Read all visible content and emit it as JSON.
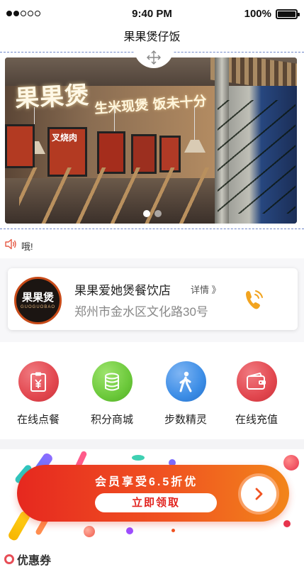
{
  "status_bar": {
    "time": "9:40 PM",
    "battery_label": "100%",
    "signal_icon": "signal-dots-icon",
    "battery_icon": "battery-icon"
  },
  "nav": {
    "title": "果果煲仔饭"
  },
  "banner": {
    "sign_text": "果果煲",
    "slogan_text": "生米现煲 饭未十分",
    "poster_texts": [
      "叉烧肉"
    ],
    "page_count": 2,
    "active_page": 1,
    "move_icon": "move-arrows-icon"
  },
  "notice": {
    "icon": "speaker-icon",
    "text": "哦!"
  },
  "store": {
    "logo_text": "果果煲",
    "logo_subtext": "GUOGUOBAO",
    "name": "果果爱她煲餐饮店",
    "detail_label": "详情 》",
    "address": "郑州市金水区文化路30号",
    "phone_icon": "phone-icon"
  },
  "menu": [
    {
      "label": "在线点餐",
      "icon": "clipboard-yuan-icon",
      "color": "#e2474f"
    },
    {
      "label": "积分商城",
      "icon": "coin-stack-icon",
      "color": "#6cc93b"
    },
    {
      "label": "步数精灵",
      "icon": "walking-person-icon",
      "color": "#3c8de6"
    },
    {
      "label": "在线充值",
      "icon": "wallet-icon",
      "color": "#e2474f"
    }
  ],
  "promo": {
    "title": "会员享受6.5折优",
    "button_label": "立即领取",
    "arrow_icon": "chevron-right-icon",
    "colors": {
      "start": "#e6281f",
      "end": "#f2851a"
    }
  },
  "coupon": {
    "title": "优惠券",
    "icon": "ring-icon",
    "color": "#e74e57"
  }
}
